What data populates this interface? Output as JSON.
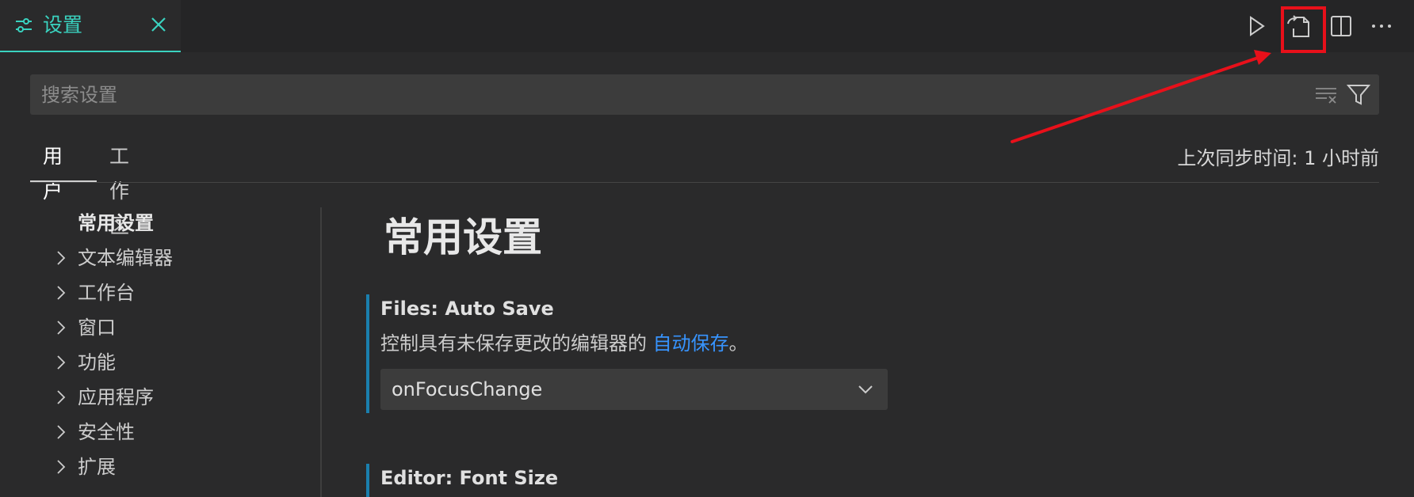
{
  "tab": {
    "label": "设置"
  },
  "search": {
    "placeholder": "搜索设置"
  },
  "scope_tabs": [
    {
      "label": "用户"
    },
    {
      "label": "工作区"
    }
  ],
  "sync_status": "上次同步时间: 1 小时前",
  "nav": {
    "items": [
      {
        "label": "常用设置"
      },
      {
        "label": "文本编辑器"
      },
      {
        "label": "工作台"
      },
      {
        "label": "窗口"
      },
      {
        "label": "功能"
      },
      {
        "label": "应用程序"
      },
      {
        "label": "安全性"
      },
      {
        "label": "扩展"
      }
    ]
  },
  "content": {
    "section_title": "常用设置",
    "settings": [
      {
        "title": "Files: Auto Save",
        "description_prefix": "控制具有未保存更改的编辑器的 ",
        "description_link": "自动保存",
        "description_suffix": "。",
        "value": "onFocusChange"
      },
      {
        "title": "Editor: Font Size"
      }
    ]
  },
  "colors": {
    "accent": "#3ad3c0",
    "link": "#3794ff",
    "annotation": "#e8101a",
    "setting_marker": "#1a7fae"
  },
  "icons": {
    "tab": "settings-sliders-icon",
    "close": "close-icon",
    "run": "play-icon",
    "open_json": "open-settings-json-icon",
    "split": "split-editor-icon",
    "more": "more-actions-icon",
    "clear": "clear-filter-icon",
    "filter": "filter-icon",
    "chevron": "chevron-right-icon",
    "dropdown": "chevron-down-icon"
  }
}
